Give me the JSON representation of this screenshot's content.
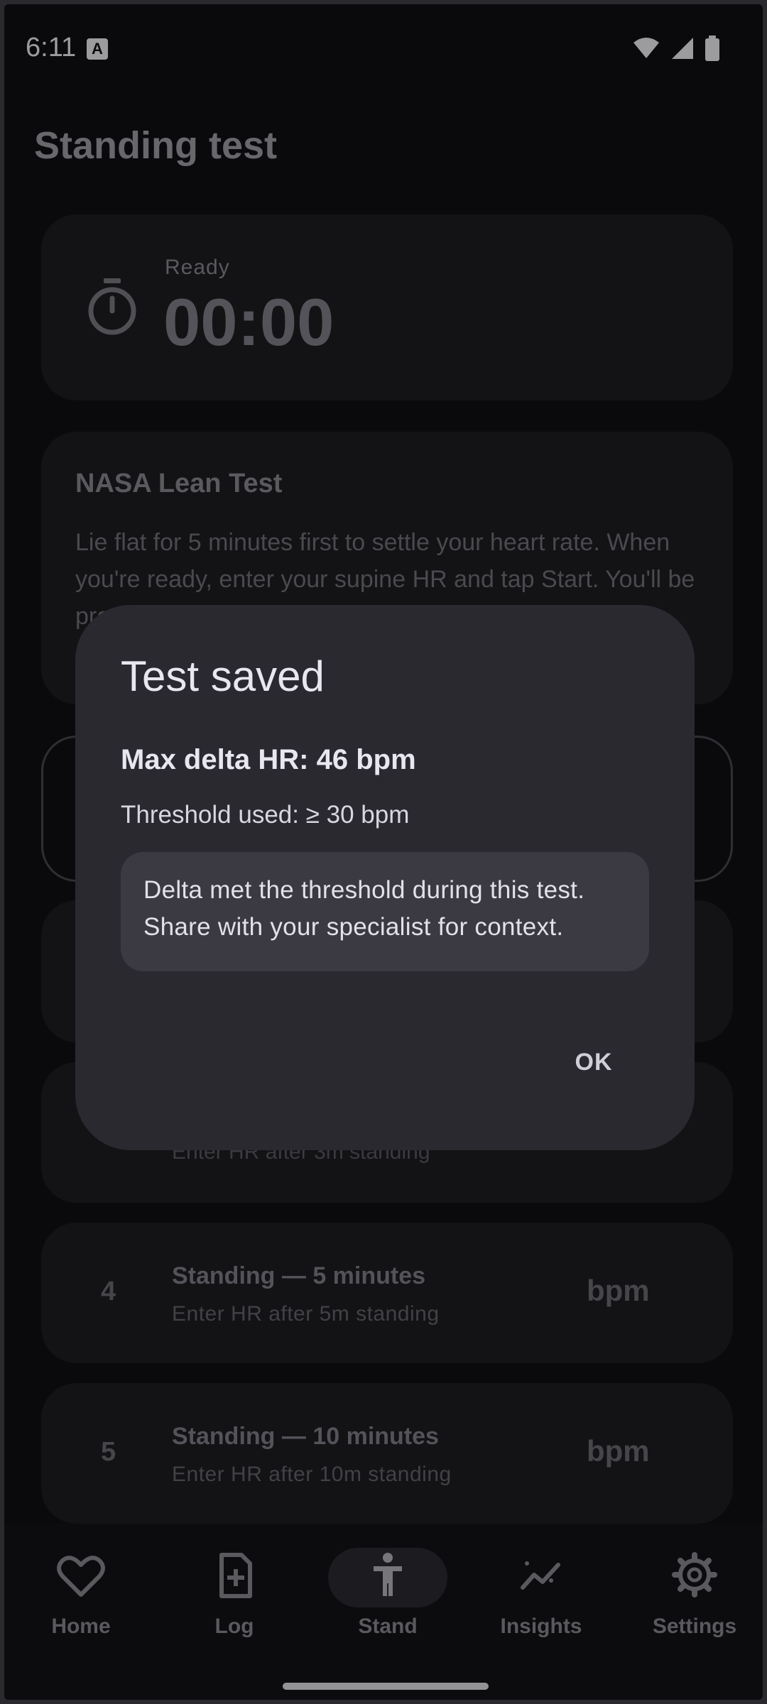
{
  "status_bar": {
    "time": "6:11",
    "notification_badge": "A"
  },
  "page": {
    "title": "Standing test"
  },
  "timer": {
    "label": "Ready",
    "value": "00:00"
  },
  "info_card": {
    "title": "NASA Lean Test",
    "body": "Lie flat for 5 minutes first to settle your heart rate. When you're ready, enter your supine HR and tap Start. You'll be prompted to enter your HR at each standing interval."
  },
  "step_3": {
    "sub": "Enter HR after 3m standing"
  },
  "steps": [
    {
      "number": "4",
      "title": "Standing — 5 minutes",
      "sub": "Enter HR after 5m standing",
      "unit": "bpm"
    },
    {
      "number": "5",
      "title": "Standing — 10 minutes",
      "sub": "Enter HR after 10m standing",
      "unit": "bpm"
    }
  ],
  "bottom_nav": {
    "items": [
      {
        "label": "Home",
        "icon": "heart-icon"
      },
      {
        "label": "Log",
        "icon": "add-document-icon"
      },
      {
        "label": "Stand",
        "icon": "standing-person-icon",
        "selected": true
      },
      {
        "label": "Insights",
        "icon": "trend-sparkle-icon"
      },
      {
        "label": "Settings",
        "icon": "gear-icon"
      }
    ]
  },
  "dialog": {
    "title": "Test saved",
    "max_delta": "Max delta HR: 46 bpm",
    "threshold": "Threshold used: ≥ 30 bpm",
    "note": "Delta met the threshold during this test. Share with your specialist for context.",
    "ok_label": "OK"
  },
  "colors": {
    "background": "#101014",
    "card": "#1c1b20",
    "dialog": "#2b2930",
    "note_box": "#3b3942"
  }
}
